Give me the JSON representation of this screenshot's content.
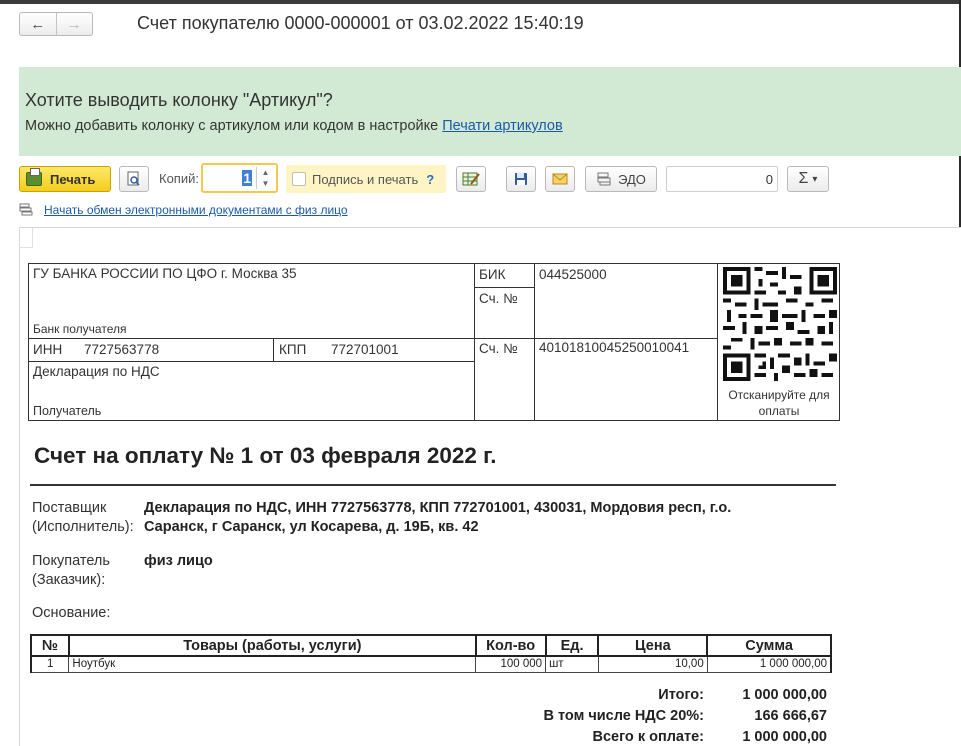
{
  "window": {
    "title": "Счет покупателю 0000-000001 от 03.02.2022 15:40:19",
    "back_icon": "←",
    "forward_icon": "→"
  },
  "banner": {
    "heading": "Хотите выводить колонку \"Артикул\"?",
    "text": "Можно добавить колонку с артикулом или кодом в настройке",
    "link": "Печати артикулов"
  },
  "toolbar": {
    "print_label": "Печать",
    "copies_label": "Копий:",
    "copies_value": "1",
    "sign_label": "Подпись и печать",
    "sign_help": "?",
    "edo_label": "ЭДО",
    "sum_value": "0",
    "sum_icon": "Σ",
    "dropdown_icon": "▾"
  },
  "edo_exchange": {
    "link": "Начать обмен электронными документами с физ лицо"
  },
  "bank_details": {
    "bank_name": "ГУ БАНКА РОССИИ ПО ЦФО г. Москва 35",
    "bank_caption": "Банк получателя",
    "bik_label": "БИК",
    "bik_value": "044525000",
    "corr_label": "Сч. №",
    "inn_label": "ИНН",
    "inn_value": "7727563778",
    "kpp_label": "КПП",
    "kpp_value": "772701001",
    "account_label": "Сч. №",
    "account_value": "40101810045250010041",
    "recipient_name": "Декларация по НДС",
    "recipient_caption": "Получатель",
    "qr_caption_1": "Отсканируйте для",
    "qr_caption_2": "оплаты"
  },
  "invoice": {
    "title": "Счет на оплату № 1 от 03 февраля 2022 г.",
    "supplier_label_1": "Поставщик",
    "supplier_label_2": "(Исполнитель):",
    "supplier_value_1": "Декларация по НДС, ИНН 7727563778, КПП 772701001, 430031, Мордовия респ, г.о.",
    "supplier_value_2": "Саранск, г Саранск, ул Косарева, д. 19Б, кв. 42",
    "buyer_label_1": "Покупатель",
    "buyer_label_2": "(Заказчик):",
    "buyer_value": "физ лицо",
    "basis_label": "Основание:"
  },
  "items_table": {
    "headers": [
      "№",
      "Товары (работы, услуги)",
      "Кол-во",
      "Ед.",
      "Цена",
      "Сумма"
    ],
    "rows": [
      [
        "1",
        "Ноутбук",
        "100 000",
        "шт",
        "10,00",
        "1 000 000,00"
      ]
    ]
  },
  "totals": {
    "total_label": "Итого:",
    "total_value": "1 000 000,00",
    "vat_label": "В том числе НДС 20%:",
    "vat_value": "166 666,67",
    "due_label": "Всего к оплате:",
    "due_value": "1 000 000,00"
  },
  "colors": {
    "banner_bg": "#d2ead3",
    "print_button": "#f4cd1c",
    "link": "#1c5aa8"
  }
}
